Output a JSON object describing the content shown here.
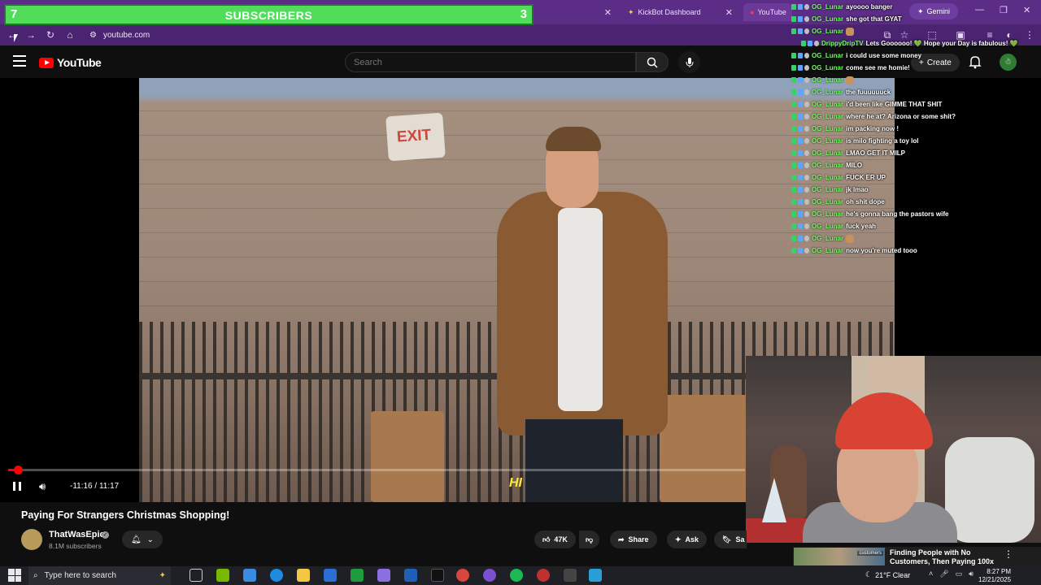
{
  "browser": {
    "tabs": [
      {
        "label": "",
        "partial": true
      },
      {
        "label": "KickBot Dashboard"
      },
      {
        "label": "YouTube"
      }
    ],
    "gemini_label": "Gemini",
    "url": "youtube.com"
  },
  "overlay": {
    "left_number": "7",
    "label": "SUBSCRIBERS",
    "right_number": "3"
  },
  "youtube": {
    "logo_text": "YouTube",
    "search_placeholder": "Search",
    "create_label": "Create"
  },
  "video": {
    "subtitle_text": "HI",
    "time_display": "-11:16 / 11:17",
    "progress_fraction": 0.002,
    "title": "Paying For Strangers Christmas Shopping!",
    "channel_name": "ThatWasEpic",
    "subscribers": "8.1M subscribers",
    "like_count": "47K",
    "share_label": "Share",
    "ask_label": "Ask",
    "save_label": "Sa"
  },
  "chat": [
    {
      "user": "OG_Lunar",
      "message": "ayoooo banger"
    },
    {
      "user": "OG_Lunar",
      "message": "she got that GYAT"
    },
    {
      "user": "OG_Lunar",
      "message": "",
      "emote": true
    },
    {
      "user": "DrippyDripTV",
      "message": "Lets Goooooo! 💚 Hope your Day is fabulous! 💚"
    },
    {
      "user": "OG_Lunar",
      "message": "i could use some money"
    },
    {
      "user": "OG_Lunar",
      "message": "come see me homie!"
    },
    {
      "user": "OG_Lunar",
      "message": "",
      "emote": true
    },
    {
      "user": "OG_Lunar",
      "message": "the fuuuuuuck"
    },
    {
      "user": "OG_Lunar",
      "message": "i'd been like GIMME THAT SHIT"
    },
    {
      "user": "OG_Lunar",
      "message": "where he at? Arizona or some shit?"
    },
    {
      "user": "OG_Lunar",
      "message": "im packing now !"
    },
    {
      "user": "OG_Lunar",
      "message": "is milo fighting a toy lol"
    },
    {
      "user": "OG_Lunar",
      "message": "LMAO GET IT MILP"
    },
    {
      "user": "OG_Lunar",
      "message": "MILO"
    },
    {
      "user": "OG_Lunar",
      "message": "FUCK ER UP"
    },
    {
      "user": "OG_Lunar",
      "message": "jk lmao"
    },
    {
      "user": "OG_Lunar",
      "message": "oh shit dope"
    },
    {
      "user": "OG_Lunar",
      "message": "he's gonna bang the pastors wife"
    },
    {
      "user": "OG_Lunar",
      "message": "fuck yeah"
    },
    {
      "user": "OG_Lunar",
      "message": "",
      "emote": true
    },
    {
      "user": "OG_Lunar",
      "message": "now you're muted tooo"
    }
  ],
  "notification": {
    "thumb_label": "customers",
    "title": "Finding People with No Customers, Then Paying 100x"
  },
  "taskbar": {
    "search_placeholder": "Type here to search",
    "weather": "21°F  Clear",
    "time": "8:27 PM",
    "date": "12/21/2025"
  },
  "colors": {
    "browser_chrome": "#5b2d86",
    "overlay_green": "#4fdd5a",
    "youtube_red": "#ff0000",
    "chat_username": "#6dff5b",
    "subtitle_yellow": "#ffea3b"
  }
}
